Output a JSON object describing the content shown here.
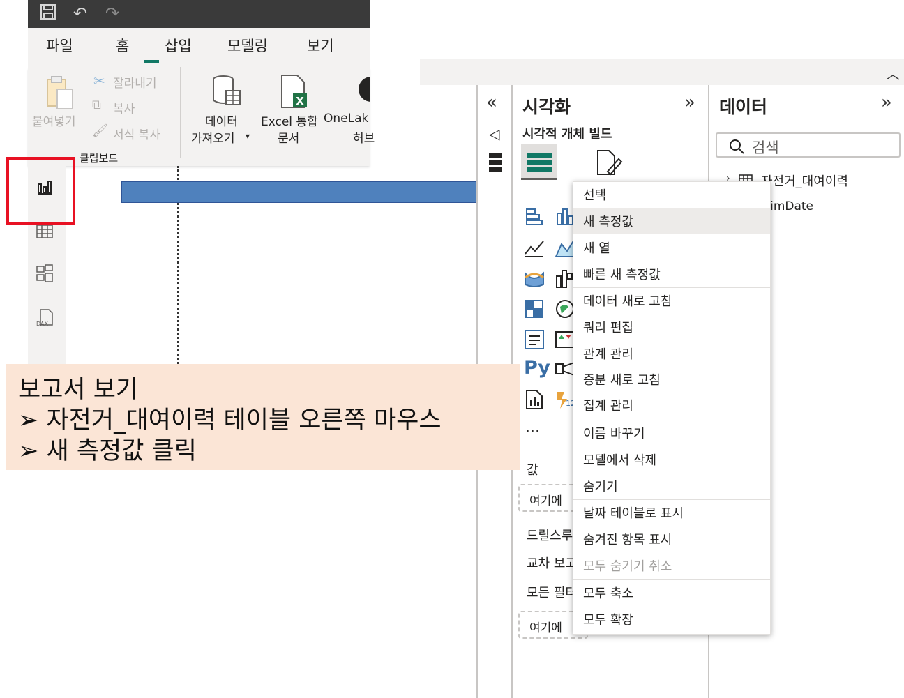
{
  "ribbon": {
    "tabs": [
      "파일",
      "홈",
      "삽입",
      "모델링",
      "보기"
    ],
    "active_tab": "홈",
    "clipboard": {
      "paste": "붙여넣기",
      "cut": "잘라내기",
      "copy": "복사",
      "format_copy": "서식 복사",
      "group": "클립보드"
    },
    "get_data": [
      "데이터",
      "가져오기"
    ],
    "excel": [
      "Excel 통합",
      "문서"
    ],
    "onelake": [
      "OneLak",
      "허브"
    ]
  },
  "visualization_pane": {
    "title": "시각화",
    "build_label": "시각적 개체 빌드",
    "values_label": "값",
    "values_well": "여기에",
    "drillthrough_label": "드릴스루",
    "cross_report_label": "교차 보고",
    "all_filters_label": "모든 필터",
    "filters_well": "여기에 ",
    "more": "...",
    "py": "Py"
  },
  "data_pane": {
    "title": "데이터",
    "search_placeholder": "검색",
    "tables": [
      "자전거_대여이력",
      "DimDate"
    ]
  },
  "context_menu": {
    "items": [
      {
        "label": "선택",
        "state": "normal"
      },
      {
        "label": "새 측정값",
        "state": "hover"
      },
      {
        "label": "새 열",
        "state": "normal"
      },
      {
        "label": "빠른 새 측정값",
        "state": "normal"
      },
      {
        "label": "데이터 새로 고침",
        "state": "normal"
      },
      {
        "label": "쿼리 편집",
        "state": "normal"
      },
      {
        "label": "관계 관리",
        "state": "normal"
      },
      {
        "label": "증분 새로 고침",
        "state": "normal"
      },
      {
        "label": "집계 관리",
        "state": "normal"
      },
      {
        "label": "이름 바꾸기",
        "state": "normal"
      },
      {
        "label": "모델에서 삭제",
        "state": "normal"
      },
      {
        "label": "숨기기",
        "state": "normal"
      },
      {
        "label": "날짜 테이블로 표시",
        "state": "normal"
      },
      {
        "label": "숨겨진 항목 표시",
        "state": "normal"
      },
      {
        "label": "모두 숨기기 취소",
        "state": "disabled"
      },
      {
        "label": "모두 축소",
        "state": "normal"
      },
      {
        "label": "모두 확장",
        "state": "normal"
      }
    ]
  },
  "annotation": {
    "title": "보고서 보기",
    "steps": [
      "자전거_대여이력 테이블 오른쪽 마우스",
      "새 측정값 클릭"
    ],
    "bullet": "➢"
  },
  "colors": {
    "accent": "#117865",
    "highlight_box": "#e81123",
    "arrow": "#4f81bd",
    "note_bg": "#fbe5d6"
  }
}
